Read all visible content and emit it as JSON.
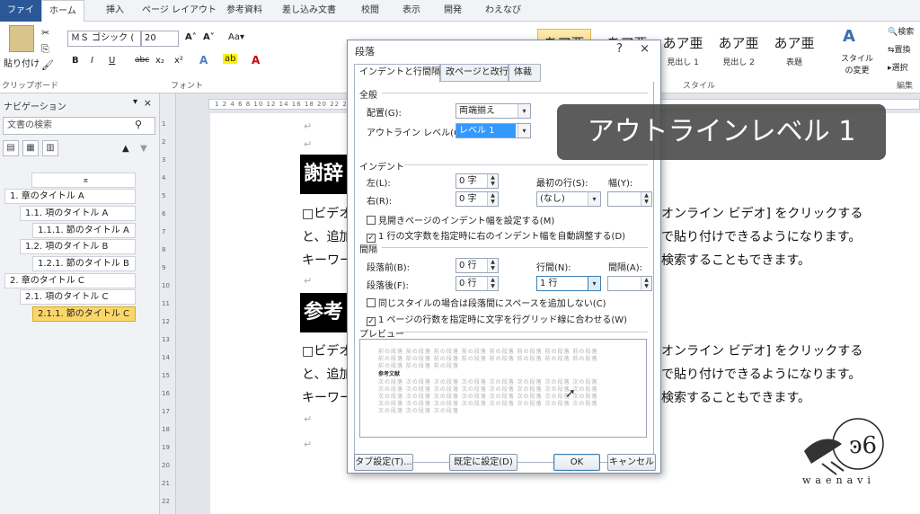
{
  "ribbon": {
    "tabs": [
      "ファイル",
      "ホーム",
      "挿入",
      "ページ レイアウト",
      "参考資料",
      "差し込み文書",
      "校閲",
      "表示",
      "開発",
      "わえなび"
    ],
    "clipboard": {
      "paste_label": "貼り付け",
      "group_label": "クリップボード"
    },
    "font": {
      "name": "ＭＳ ゴシック (",
      "size": "20",
      "group_label": "フォント",
      "bold": "B",
      "italic": "I",
      "underline": "U",
      "strike": "abc",
      "sub": "x₂",
      "sup": "x²"
    },
    "styles": {
      "items": [
        {
          "sample": "あア亜",
          "name": "見出し 1"
        },
        {
          "sample": "あア亜",
          "name": "見出し 2"
        },
        {
          "sample": "あア亜",
          "name": "表題"
        }
      ],
      "change_label": "スタイルの変更",
      "group_label": "スタイル"
    },
    "editing": {
      "find": "検索",
      "replace": "置換",
      "select": "選択",
      "group_label": "編集"
    }
  },
  "navigation": {
    "title": "ナビゲーション",
    "search_placeholder": "文書の検索",
    "items": [
      {
        "label": "1.  章のタイトル A"
      },
      {
        "label": "1.1.  項のタイトル A"
      },
      {
        "label": "1.1.1.  節のタイトル A"
      },
      {
        "label": "1.2.  項のタイトル B"
      },
      {
        "label": "1.2.1.  節のタイトル B"
      },
      {
        "label": "2.  章のタイトル C"
      },
      {
        "label": "2.1.  項のタイトル C"
      },
      {
        "label": "2.1.1.  節のタイトル C"
      }
    ]
  },
  "document": {
    "heading1": "謝辞",
    "heading2": "参考",
    "line_a1": "□ビデオ",
    "line_a2": "と、追加",
    "line_a3": "キーワー",
    "right_a1": "オンライン ビデオ] をクリックする",
    "right_a2": "で貼り付けできるようになります。",
    "right_a3": "検索することもできます。",
    "ruler_marks": "1  2  4  6  8  10  12  14  16  18  20  22  24  26  28  30  32  34  36  38  40",
    "ruler_v": [
      "1",
      "2",
      "3",
      "4",
      "5",
      "6",
      "7",
      "8",
      "9",
      "10",
      "11",
      "12",
      "13",
      "14",
      "15",
      "16",
      "17",
      "18",
      "19",
      "20",
      "21",
      "22"
    ]
  },
  "dialog": {
    "title": "段落",
    "help": "?",
    "close": "×",
    "tabs": [
      "インデントと行間隔",
      "改ページと改行",
      "体裁"
    ],
    "general": {
      "section": "全般",
      "alignment_label": "配置(G):",
      "alignment_value": "両端揃え",
      "outline_label": "アウトライン レベル(O):",
      "outline_value": "レベル 1"
    },
    "indent": {
      "section": "インデント",
      "left_label": "左(L):",
      "left_value": "0 字",
      "right_label": "右(R):",
      "right_value": "0 字",
      "first_label": "最初の行(S):",
      "first_value": "(なし)",
      "width_label": "幅(Y):",
      "mirror_label": "見開きページのインデント幅を設定する(M)",
      "auto_label": "1 行の文字数を指定時に右のインデント幅を自動調整する(D)"
    },
    "spacing": {
      "section": "間隔",
      "before_label": "段落前(B):",
      "before_value": "0 行",
      "after_label": "段落後(F):",
      "after_value": "0 行",
      "line_label": "行間(N):",
      "line_value": "1 行",
      "at_label": "間隔(A):",
      "same_style_label": "同じスタイルの場合は段落間にスペースを追加しない(C)",
      "grid_label": "1 ページの行数を指定時に文字を行グリッド線に合わせる(W)"
    },
    "preview": {
      "section": "プレビュー",
      "sample_text": "前の段落 前の段落 前の段落 前の段落 前の段落 前の段落 前の段落 前の段落",
      "sample_text2": "前の段落 前の段落 前の段落",
      "heading_text": "参考文献",
      "next_text": "次の段落 次の段落 次の段落 次の段落 次の段落 次の段落 次の段落 次の段落",
      "next_text2": "次の段落 次の段落 次の段落"
    },
    "buttons": {
      "tabs": "タブ設定(T)...",
      "default": "既定に設定(D)",
      "ok": "OK",
      "cancel": "キャンセル"
    }
  },
  "callout": "アウトラインレベル 1",
  "logo_text": "waenavi"
}
